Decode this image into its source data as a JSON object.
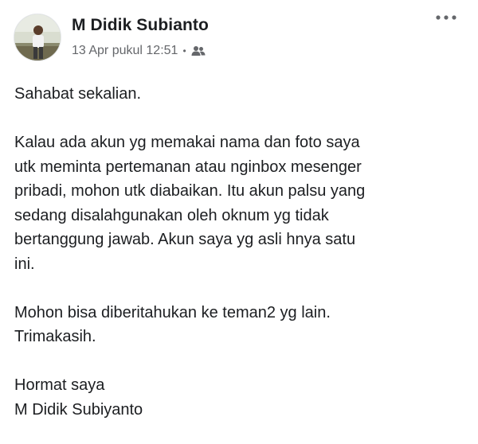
{
  "post": {
    "author": "M Didik Subianto",
    "timestamp": "13 Apr pukul 12:51",
    "separator": "•",
    "audience_icon": "friends-icon",
    "more_icon": "more-options-icon",
    "paragraphs": [
      "Sahabat sekalian.",
      "Kalau ada akun yg memakai nama dan foto saya\nutk meminta pertemanan atau nginbox mesenger\npribadi, mohon utk diabaikan. Itu akun palsu yang\nsedang disalahgunakan oleh oknum yg tidak\nbertanggung jawab. Akun saya yg asli hnya satu\nini.",
      "Mohon bisa diberitahukan ke teman2 yg lain.\nTrimakasih.",
      "Hormat saya\nM Didik Subiyanto"
    ]
  },
  "colors": {
    "text": "#1c1e21",
    "secondary_text": "#65676b",
    "background": "#ffffff"
  }
}
